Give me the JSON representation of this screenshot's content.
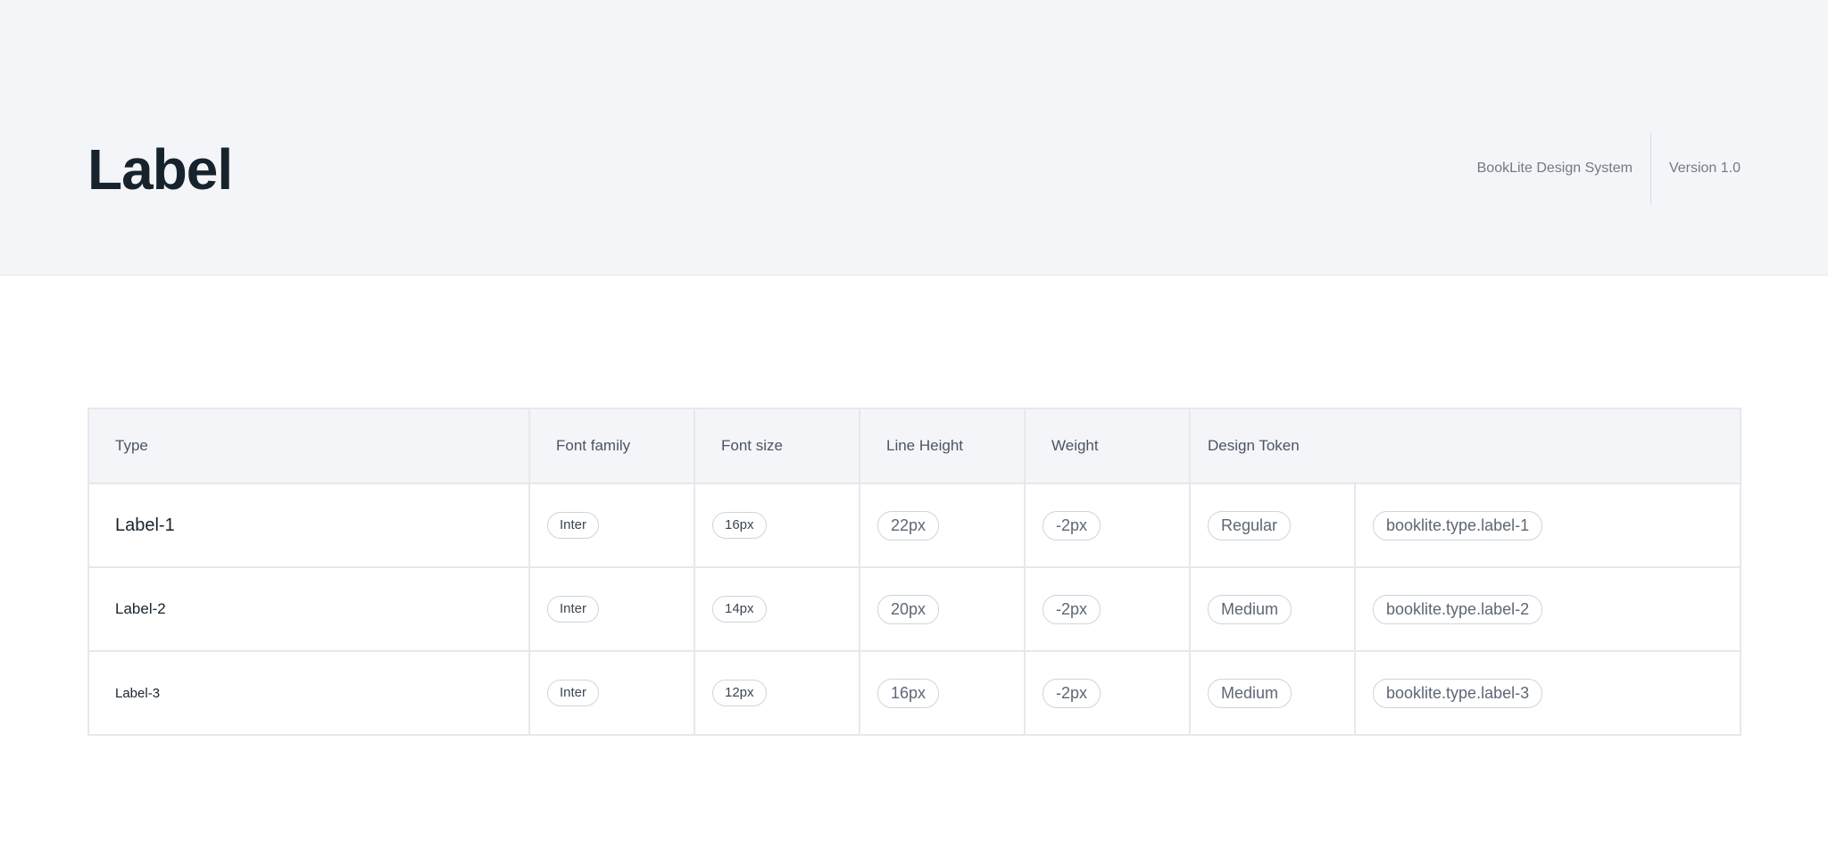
{
  "header": {
    "title": "Label",
    "system_name": "BookLite Design System",
    "version": "Version 1.0"
  },
  "table": {
    "columns": [
      "Type",
      "Font family",
      "Font size",
      "Line Height",
      "Weight",
      "Design Token"
    ],
    "rows": [
      {
        "type": "Label-1",
        "font_family": "Inter",
        "font_size": "16px",
        "line_height": "22px",
        "letter_spacing": "-2px",
        "weight": "Regular",
        "token": "booklite.type.label-1"
      },
      {
        "type": "Label-2",
        "font_family": "Inter",
        "font_size": "14px",
        "line_height": "20px",
        "letter_spacing": "-2px",
        "weight": "Medium",
        "token": "booklite.type.label-2"
      },
      {
        "type": "Label-3",
        "font_family": "Inter",
        "font_size": "12px",
        "line_height": "16px",
        "letter_spacing": "-2px",
        "weight": "Medium",
        "token": "booklite.type.label-3"
      }
    ]
  },
  "colors": {
    "header_bg": "#f4f5f8",
    "border": "#e6e8ec",
    "pill_border": "#cfd4db",
    "title": "#17232c",
    "muted_text": "#707a86"
  }
}
